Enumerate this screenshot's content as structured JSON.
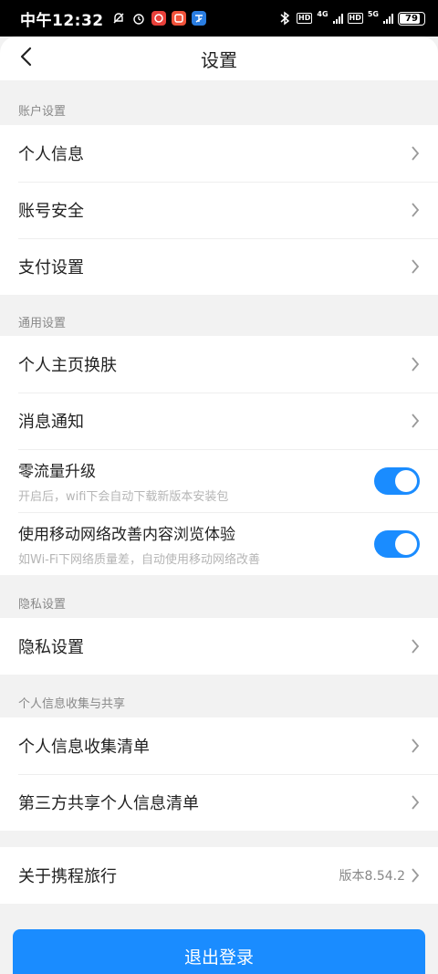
{
  "status_bar": {
    "time": "中午12:32",
    "battery": "79",
    "net_left": "4G",
    "net_right": "5G",
    "hd": "HD"
  },
  "header": {
    "title": "设置"
  },
  "sections": [
    {
      "label": "账户设置",
      "items": [
        {
          "label": "个人信息"
        },
        {
          "label": "账号安全"
        },
        {
          "label": "支付设置"
        }
      ]
    },
    {
      "label": "通用设置",
      "items": [
        {
          "label": "个人主页换肤"
        },
        {
          "label": "消息通知"
        }
      ],
      "toggles": [
        {
          "label": "零流量升级",
          "desc": "开启后，wifi下会自动下载新版本安装包",
          "on": true
        },
        {
          "label": "使用移动网络改善内容浏览体验",
          "desc": "如Wi-Fi下网络质量差，自动使用移动网络改善",
          "on": true
        }
      ]
    },
    {
      "label": "隐私设置",
      "items": [
        {
          "label": "隐私设置"
        }
      ]
    },
    {
      "label": "个人信息收集与共享",
      "items": [
        {
          "label": "个人信息收集清单"
        },
        {
          "label": "第三方共享个人信息清单"
        }
      ]
    }
  ],
  "about": {
    "label": "关于携程旅行",
    "version": "版本8.54.2"
  },
  "logout": {
    "label": "退出登录"
  },
  "colors": {
    "accent": "#1a8cff",
    "background": "#f2f2f2"
  }
}
